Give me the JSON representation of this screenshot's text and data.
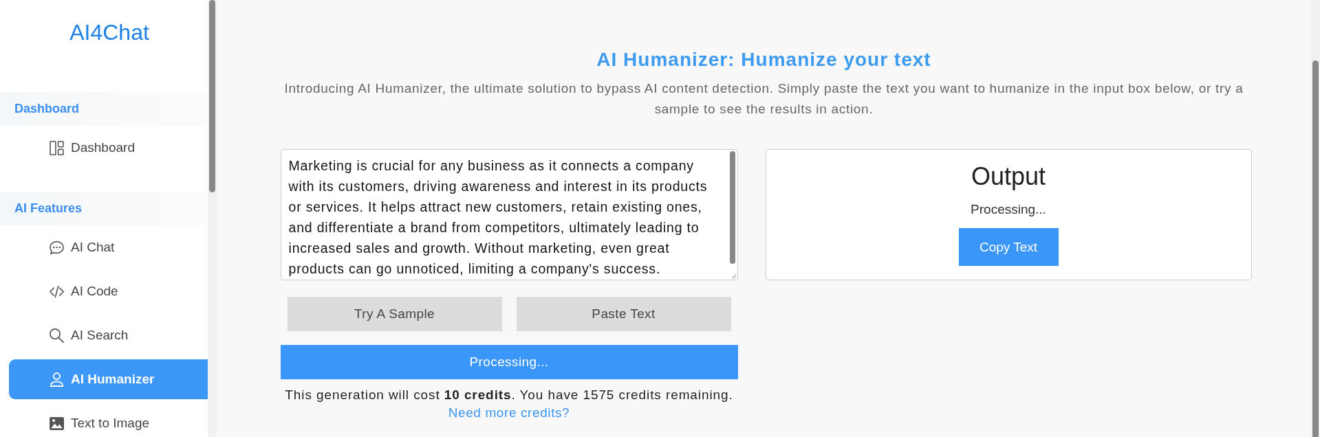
{
  "sidebar": {
    "logo": "AI4Chat",
    "sections": [
      {
        "title": "Dashboard",
        "items": [
          {
            "label": "Dashboard",
            "selected": false
          }
        ]
      },
      {
        "title": "AI Features",
        "items": [
          {
            "label": "AI Chat",
            "selected": false
          },
          {
            "label": "AI Code",
            "selected": false
          },
          {
            "label": "AI Search",
            "selected": false
          },
          {
            "label": "AI Humanizer",
            "selected": true
          },
          {
            "label": "Text to Image",
            "selected": false
          }
        ]
      }
    ]
  },
  "main": {
    "title": "AI Humanizer: Humanize your text",
    "description": "Introducing AI Humanizer, the ultimate solution to bypass AI content detection. Simply paste the text you want to humanize in the input box below, or try a sample to see the results in action.",
    "input": {
      "value": "Marketing is crucial for any business as it connects a company with its customers, driving awareness and interest in its products or services. It helps attract new customers, retain existing ones, and differentiate a brand from competitors, ultimately leading to increased sales and growth. Without marketing, even great products can go unnoticed, limiting a company's success."
    },
    "buttons": [
      "Try A Sample",
      "Paste Text"
    ],
    "submit_button": "Processing...",
    "cost_note": "This generation will cost **10 credits**. You have 1575 credits remaining.",
    "credits_link": "Need more credits?",
    "output": {
      "title": "Output",
      "status": "Processing...",
      "copy_button": "Copy Text"
    }
  }
}
